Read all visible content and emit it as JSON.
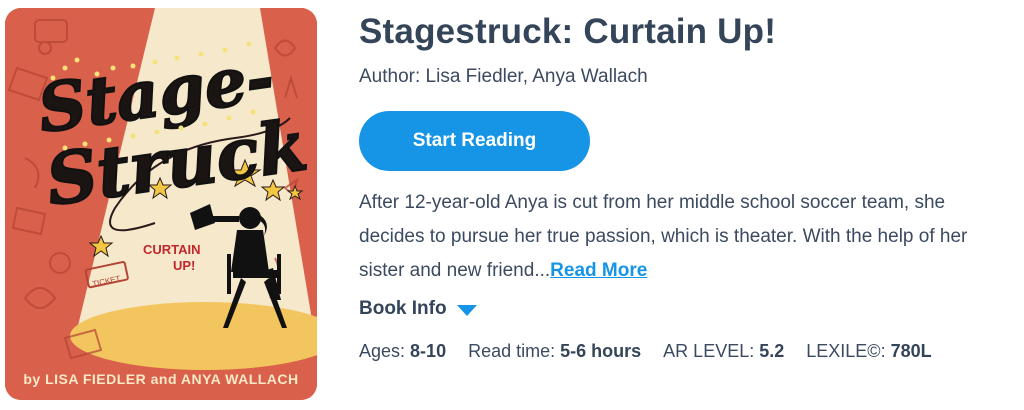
{
  "book": {
    "title": "Stagestruck: Curtain Up!",
    "author_label": "Author:",
    "authors": "Lisa Fiedler, Anya Wallach",
    "start_reading_label": "Start Reading",
    "description": "After 12-year-old Anya is cut from her middle school soccer team, she decides to pursue her true passion, which is theater. With the help of her sister and new friend...",
    "read_more_label": "Read More",
    "book_info_label": "Book Info",
    "meta": {
      "ages_label": "Ages:",
      "ages_value": "8-10",
      "read_time_label": "Read time:",
      "read_time_value": "5-6 hours",
      "ar_label": "AR LEVEL:",
      "ar_value": "5.2",
      "lexile_label": "LEXILE©:",
      "lexile_value": "780L"
    }
  },
  "cover": {
    "title_line1": "Stage-",
    "title_line2": "Struck",
    "subtitle_line1": "CURTAIN",
    "subtitle_line2": "UP!",
    "byline": "by LISA FIEDLER and ANYA WALLACH",
    "ticket_text": "TICKET"
  },
  "colors": {
    "accent": "#1694e6",
    "text_dark": "#354559",
    "cover_red": "#d9604a"
  }
}
